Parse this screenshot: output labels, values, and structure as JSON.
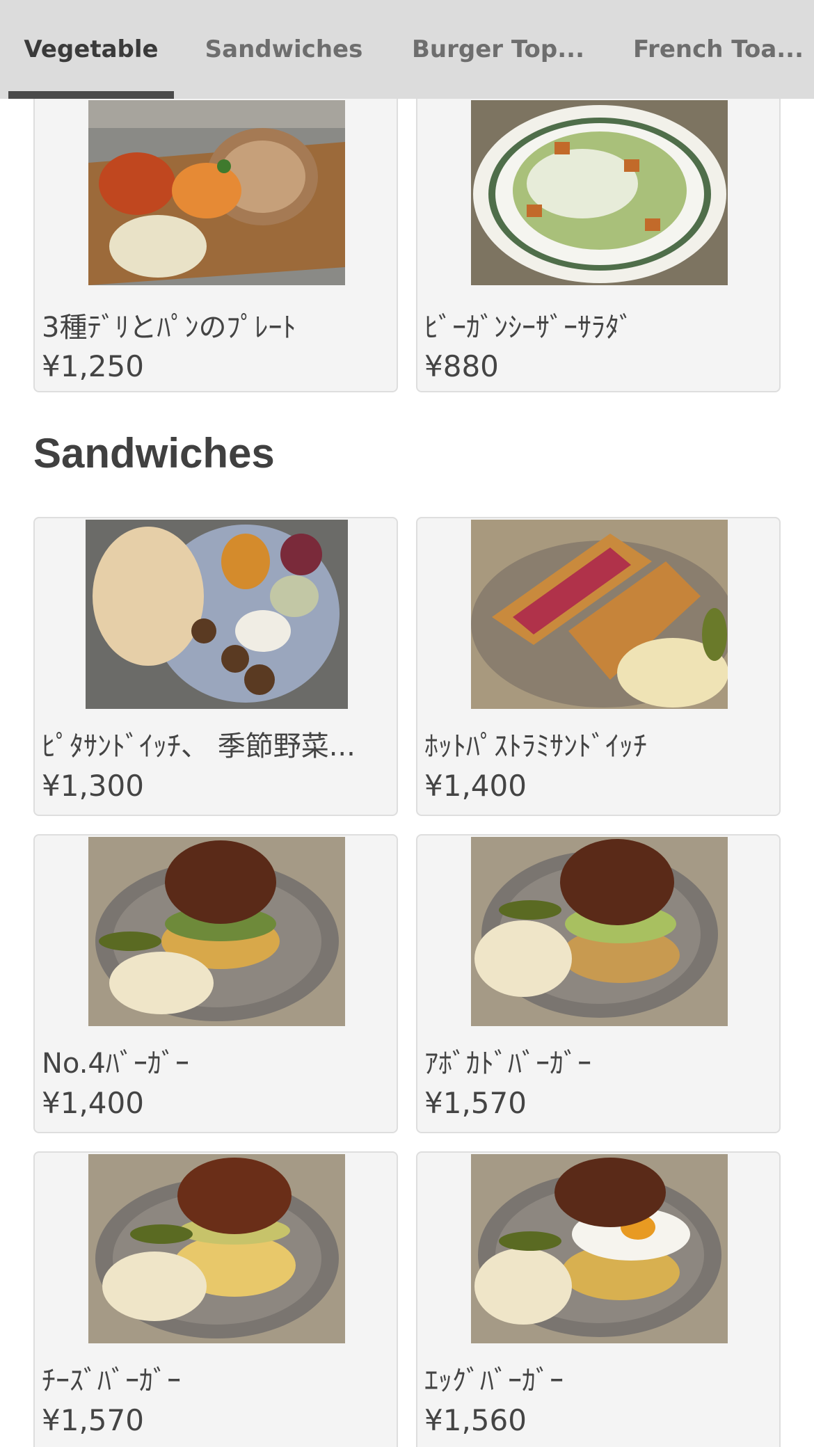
{
  "tabs": [
    {
      "label": "Vegetable",
      "active": true
    },
    {
      "label": "Sandwiches",
      "active": false
    },
    {
      "label": "Burger Top...",
      "active": false
    },
    {
      "label": "French Toa...",
      "active": false
    }
  ],
  "sections": {
    "sandwiches_title": "Sandwiches"
  },
  "items": [
    {
      "name": "3種ﾃﾞﾘとﾊﾟﾝのﾌﾟﾚｰﾄ",
      "price": "¥1,250",
      "image": "deli-plate"
    },
    {
      "name": "ﾋﾞｰｶﾞﾝｼｰｻﾞｰｻﾗﾀﾞ",
      "price": "¥880",
      "image": "caesar-salad"
    },
    {
      "name": "ﾋﾟﾀｻﾝﾄﾞｲｯﾁ、 季節野菜...",
      "price": "¥1,300",
      "image": "pita-plate"
    },
    {
      "name": "ﾎｯﾄﾊﾟｽﾄﾗﾐｻﾝﾄﾞｲｯﾁ",
      "price": "¥1,400",
      "image": "pastrami-sandwich"
    },
    {
      "name": "No.4ﾊﾞｰｶﾞｰ",
      "price": "¥1,400",
      "image": "burger"
    },
    {
      "name": "ｱﾎﾞｶﾄﾞﾊﾞｰｶﾞｰ",
      "price": "¥1,570",
      "image": "avocado-burger"
    },
    {
      "name": "ﾁｰｽﾞﾊﾞｰｶﾞｰ",
      "price": "¥1,570",
      "image": "cheese-burger"
    },
    {
      "name": "ｴｯｸﾞﾊﾞｰｶﾞｰ",
      "price": "¥1,560",
      "image": "egg-burger"
    }
  ],
  "colors": {
    "tabbar_bg": "#dcdcdc",
    "indicator": "#4a4a4a",
    "card_bg": "#f4f4f4",
    "text": "#444444"
  }
}
